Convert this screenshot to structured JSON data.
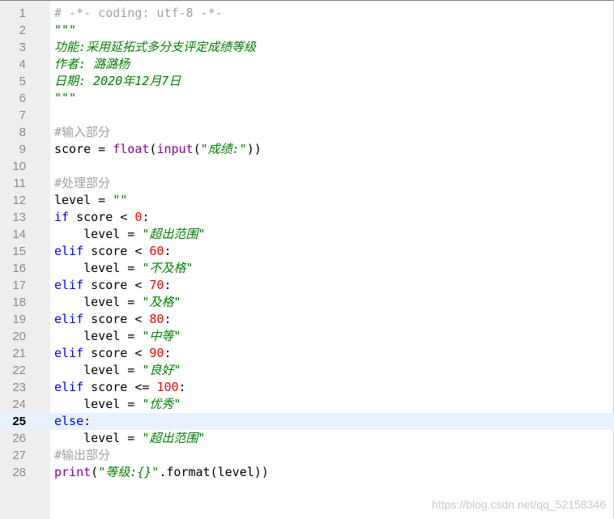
{
  "editor": {
    "current_line": 25,
    "lines": [
      {
        "no": "1",
        "text": "# -*- coding: utf-8 -*-"
      },
      {
        "no": "2",
        "text": "\"\"\""
      },
      {
        "no": "3",
        "text": "功能:采用延拓式多分支评定成绩等级"
      },
      {
        "no": "4",
        "text": "作者: 潞潞杨"
      },
      {
        "no": "5",
        "text": "日期: 2020年12月7日"
      },
      {
        "no": "6",
        "text": "\"\"\""
      },
      {
        "no": "7",
        "text": ""
      },
      {
        "no": "8",
        "text": "#输入部分"
      },
      {
        "no": "9",
        "text": "score = float(input(\"成绩:\"))"
      },
      {
        "no": "10",
        "text": ""
      },
      {
        "no": "11",
        "text": "#处理部分"
      },
      {
        "no": "12",
        "text": "level = \"\""
      },
      {
        "no": "13",
        "text": "if score < 0:"
      },
      {
        "no": "14",
        "text": "    level = \"超出范围\""
      },
      {
        "no": "15",
        "text": "elif score < 60:"
      },
      {
        "no": "16",
        "text": "    level = \"不及格\""
      },
      {
        "no": "17",
        "text": "elif score < 70:"
      },
      {
        "no": "18",
        "text": "    level = \"及格\""
      },
      {
        "no": "19",
        "text": "elif score < 80:"
      },
      {
        "no": "20",
        "text": "    level = \"中等\""
      },
      {
        "no": "21",
        "text": "elif score < 90:"
      },
      {
        "no": "22",
        "text": "    level = \"良好\""
      },
      {
        "no": "23",
        "text": "elif score <= 100:"
      },
      {
        "no": "24",
        "text": "    level = \"优秀\""
      },
      {
        "no": "25",
        "text": "else:"
      },
      {
        "no": "26",
        "text": "    level = \"超出范围\""
      },
      {
        "no": "27",
        "text": "#输出部分"
      },
      {
        "no": "28",
        "text": "print(\"等级:{}\".format(level))"
      }
    ]
  },
  "watermark": "https://blog.csdn.net/qq_52158346",
  "colors": {
    "keyword": "#0000ff",
    "builtin": "#900090",
    "string": "#008000",
    "number": "#ff0000",
    "comment": "#a0a0a0",
    "gutter_bg": "#eeeeee",
    "current_line_bg": "#e8f2fe"
  }
}
